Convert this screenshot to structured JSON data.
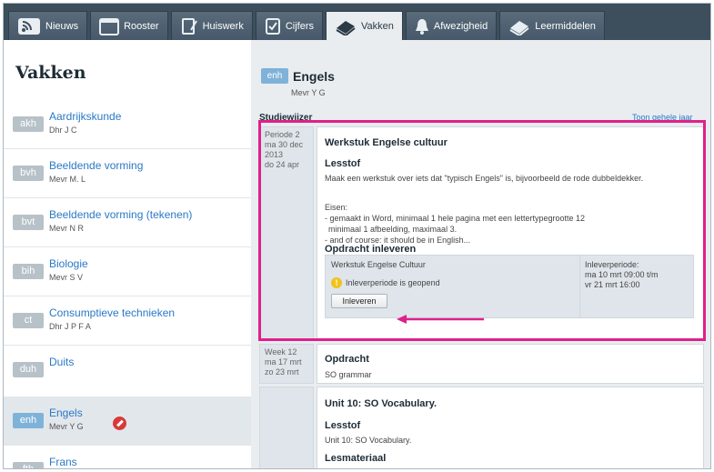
{
  "nav": {
    "tabs": [
      {
        "label": "Nieuws",
        "icon": "rss-icon",
        "active": false
      },
      {
        "label": "Rooster",
        "icon": "calendar-icon",
        "active": false
      },
      {
        "label": "Huiswerk",
        "icon": "homework-icon",
        "active": false
      },
      {
        "label": "Cijfers",
        "icon": "grades-icon",
        "active": false
      },
      {
        "label": "Vakken",
        "icon": "books-icon",
        "active": true
      },
      {
        "label": "Afwezigheid",
        "icon": "bell-icon",
        "active": false
      },
      {
        "label": "Leermiddelen",
        "icon": "learning-materials-icon",
        "active": false
      }
    ]
  },
  "sidebar": {
    "title": "Vakken",
    "items": [
      {
        "abbr": "akh",
        "name": "Aardrijkskunde",
        "teacher": "Dhr J C",
        "selected": false
      },
      {
        "abbr": "bvh",
        "name": "Beeldende vorming",
        "teacher": "Mevr M. L",
        "selected": false
      },
      {
        "abbr": "bvt",
        "name": "Beeldende vorming (tekenen)",
        "teacher": "Mevr N R",
        "selected": false
      },
      {
        "abbr": "bih",
        "name": "Biologie",
        "teacher": "Mevr S V",
        "selected": false
      },
      {
        "abbr": "ct",
        "name": "Consumptieve technieken",
        "teacher": "Dhr J P F A",
        "selected": false
      },
      {
        "abbr": "duh",
        "name": "Duits",
        "teacher": "",
        "selected": false
      },
      {
        "abbr": "enh",
        "name": "Engels",
        "teacher": "Mevr Y G",
        "selected": true
      },
      {
        "abbr": "fth",
        "name": "Frans",
        "teacher": "",
        "selected": false
      }
    ]
  },
  "main": {
    "course": {
      "abbr": "enh",
      "title": "Engels",
      "teacher": "Mevr Y G"
    },
    "studiewijzer_label": "Studiewijzer",
    "show_year_link": "Toon gehele jaar",
    "entries": [
      {
        "period": [
          "Periode 2",
          "ma 30 dec",
          "2013",
          "do 24 apr"
        ],
        "title": "Werkstuk Engelse cultuur",
        "lesstof_label": "Lesstof",
        "lesstof_text": "Maak een werkstuk over iets dat \"typisch Engels\" is, bijvoorbeeld de rode dubbeldekker.",
        "eisen_label": "Eisen:",
        "eisen": [
          "- gemaakt in Word, minimaal 1 hele pagina met een lettertypegrootte 12",
          "  minimaal 1 afbeelding, maximaal 3.",
          "- and of course: it should be in English..."
        ],
        "opdracht_label": "Opdracht inleveren",
        "opdracht": {
          "name": "Werkstuk Engelse Cultuur",
          "status": "Inleverperiode is geopend",
          "button": "Inleveren",
          "period_label": "Inleverperiode:",
          "from": "ma 10 mrt 09:00 t/m",
          "to": "vr 21 mrt 16:00"
        }
      },
      {
        "period": [
          "Week 12",
          "ma 17 mrt",
          "zo 23 mrt"
        ],
        "title": "Opdracht",
        "text": "SO grammar"
      },
      {
        "title": "Unit 10: SO Vocabulary.",
        "lesstof_label": "Lesstof",
        "lesstof_text": "Unit 10: SO Vocabulary.",
        "lesmateriaal_label": "Lesmateriaal"
      }
    ]
  },
  "colors": {
    "highlight": "#e0208a",
    "nav_bg": "#3d4f5d",
    "link": "#2a78c6",
    "accent_badge": "#7fb2d9"
  }
}
